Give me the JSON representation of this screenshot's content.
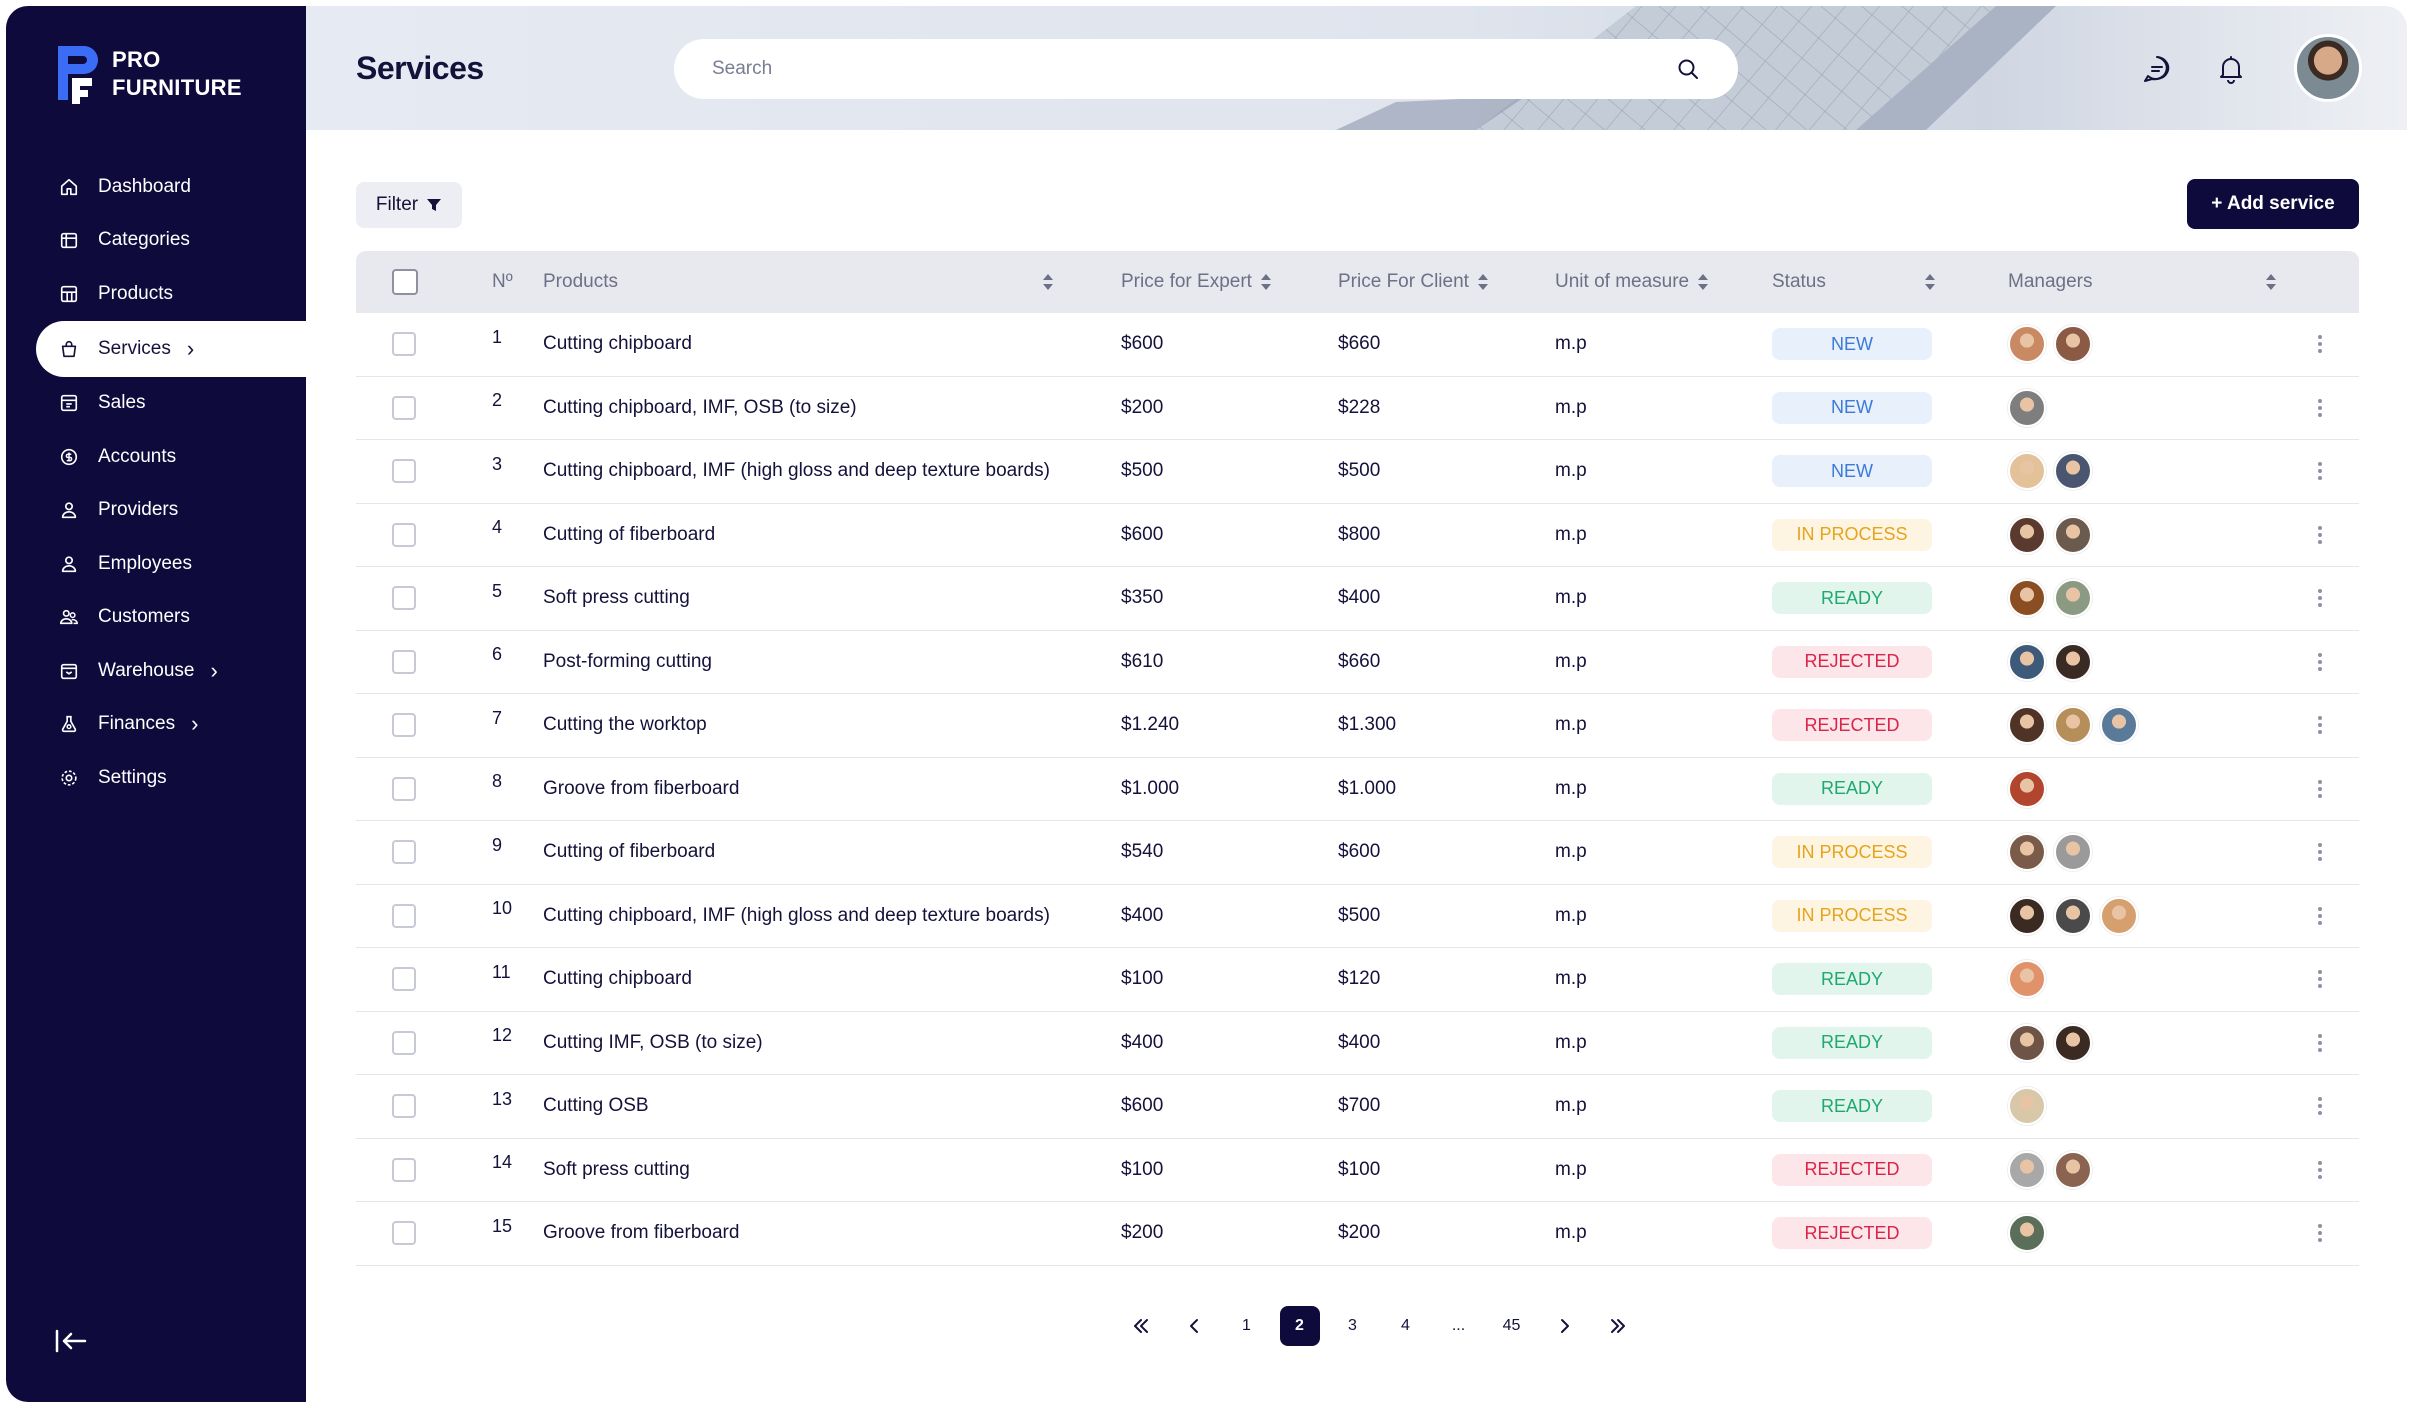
{
  "brand": {
    "line1": "PRO",
    "line2": "FURNITURE"
  },
  "nav": [
    {
      "label": "Dashboard",
      "icon": "home-icon",
      "chevron": false,
      "active": false
    },
    {
      "label": "Categories",
      "icon": "calendar-icon",
      "chevron": false,
      "active": false
    },
    {
      "label": "Products",
      "icon": "grid-icon",
      "chevron": false,
      "active": false
    },
    {
      "label": "Services",
      "icon": "bag-icon",
      "chevron": true,
      "active": true
    },
    {
      "label": "Sales",
      "icon": "receipt-icon",
      "chevron": false,
      "active": false
    },
    {
      "label": "Accounts",
      "icon": "dollar-icon",
      "chevron": false,
      "active": false
    },
    {
      "label": "Providers",
      "icon": "user-icon",
      "chevron": false,
      "active": false
    },
    {
      "label": "Employees",
      "icon": "user-icon",
      "chevron": false,
      "active": false
    },
    {
      "label": "Customers",
      "icon": "users-icon",
      "chevron": false,
      "active": false
    },
    {
      "label": "Warehouse",
      "icon": "box-icon",
      "chevron": true,
      "active": false
    },
    {
      "label": "Finances",
      "icon": "flask-icon",
      "chevron": true,
      "active": false
    },
    {
      "label": "Settings",
      "icon": "gear-icon",
      "chevron": false,
      "active": false
    }
  ],
  "header": {
    "title": "Services",
    "search_placeholder": "Search"
  },
  "toolbar": {
    "filter_label": "Filter",
    "add_label": "+ Add service"
  },
  "table": {
    "headers": {
      "no": "Nº",
      "products": "Products",
      "price_expert": "Price for Expert",
      "price_client": "Price For Client",
      "unit": "Unit of measure",
      "status": "Status",
      "managers": "Managers"
    },
    "rows": [
      {
        "no": "1",
        "product": "Cutting chipboard",
        "expert": "$600",
        "client": "$660",
        "unit": "m.p",
        "status": "NEW",
        "status_kind": "new",
        "managers": [
          "#c98a63",
          "#8a5a45"
        ]
      },
      {
        "no": "2",
        "product": "Cutting chipboard, IMF, OSB (to size)",
        "expert": "$200",
        "client": "$228",
        "unit": "m.p",
        "status": "NEW",
        "status_kind": "new",
        "managers": [
          "#7e7e7e"
        ]
      },
      {
        "no": "3",
        "product": "Cutting chipboard, IMF (high gloss and deep texture boards)",
        "expert": "$500",
        "client": "$500",
        "unit": "m.p",
        "status": "NEW",
        "status_kind": "new",
        "managers": [
          "#e3c29a",
          "#4a5670"
        ]
      },
      {
        "no": "4",
        "product": "Cutting of fiberboard",
        "expert": "$600",
        "client": "$800",
        "unit": "m.p",
        "status": "IN PROCESS",
        "status_kind": "process",
        "managers": [
          "#5a3a2e",
          "#6b5a4e"
        ]
      },
      {
        "no": "5",
        "product": "Soft press cutting",
        "expert": "$350",
        "client": "$400",
        "unit": "m.p",
        "status": "READY",
        "status_kind": "ready",
        "managers": [
          "#8a4e22",
          "#8b9a82"
        ]
      },
      {
        "no": "6",
        "product": "Post-forming cutting",
        "expert": "$610",
        "client": "$660",
        "unit": "m.p",
        "status": "REJECTED",
        "status_kind": "rejected",
        "managers": [
          "#3d5a7a",
          "#3a2a24"
        ]
      },
      {
        "no": "7",
        "product": "Cutting the worktop",
        "expert": "$1.240",
        "client": "$1.300",
        "unit": "m.p",
        "status": "REJECTED",
        "status_kind": "rejected",
        "managers": [
          "#4e3326",
          "#b58e5a",
          "#5a7a9a"
        ]
      },
      {
        "no": "8",
        "product": "Groove from fiberboard",
        "expert": "$1.000",
        "client": "$1.000",
        "unit": "m.p",
        "status": "READY",
        "status_kind": "ready",
        "managers": [
          "#b2452e"
        ]
      },
      {
        "no": "9",
        "product": "Cutting of fiberboard",
        "expert": "$540",
        "client": "$600",
        "unit": "m.p",
        "status": "IN PROCESS",
        "status_kind": "process",
        "managers": [
          "#7a5a48",
          "#9a9a9a"
        ]
      },
      {
        "no": "10",
        "product": "Cutting chipboard, IMF (high gloss and deep texture boards)",
        "expert": "$400",
        "client": "$500",
        "unit": "m.p",
        "status": "IN PROCESS",
        "status_kind": "process",
        "managers": [
          "#3a2a22",
          "#4a4a4a",
          "#d6a06e"
        ]
      },
      {
        "no": "11",
        "product": "Cutting chipboard",
        "expert": "$100",
        "client": "$120",
        "unit": "m.p",
        "status": "READY",
        "status_kind": "ready",
        "managers": [
          "#e0936a"
        ]
      },
      {
        "no": "12",
        "product": "Cutting IMF, OSB (to size)",
        "expert": "$400",
        "client": "$400",
        "unit": "m.p",
        "status": "READY",
        "status_kind": "ready",
        "managers": [
          "#6e5446",
          "#3a2a22"
        ]
      },
      {
        "no": "13",
        "product": "Cutting OSB",
        "expert": "$600",
        "client": "$700",
        "unit": "m.p",
        "status": "READY",
        "status_kind": "ready",
        "managers": [
          "#d8c7a8"
        ]
      },
      {
        "no": "14",
        "product": "Soft press cutting",
        "expert": "$100",
        "client": "$100",
        "unit": "m.p",
        "status": "REJECTED",
        "status_kind": "rejected",
        "managers": [
          "#a8a8a8",
          "#8a6450"
        ]
      },
      {
        "no": "15",
        "product": "Groove from fiberboard",
        "expert": "$200",
        "client": "$200",
        "unit": "m.p",
        "status": "REJECTED",
        "status_kind": "rejected",
        "managers": [
          "#5a6e5a"
        ]
      }
    ]
  },
  "pagination": {
    "pages": [
      "1",
      "2",
      "3",
      "4",
      "...",
      "45"
    ],
    "current": "2"
  },
  "colors": {
    "sidebar": "#0f0a3c",
    "accent": "#0f0a3c",
    "new": "#3b7ad9",
    "process": "#e6a41e",
    "ready": "#1fa870",
    "rejected": "#d8264a"
  }
}
